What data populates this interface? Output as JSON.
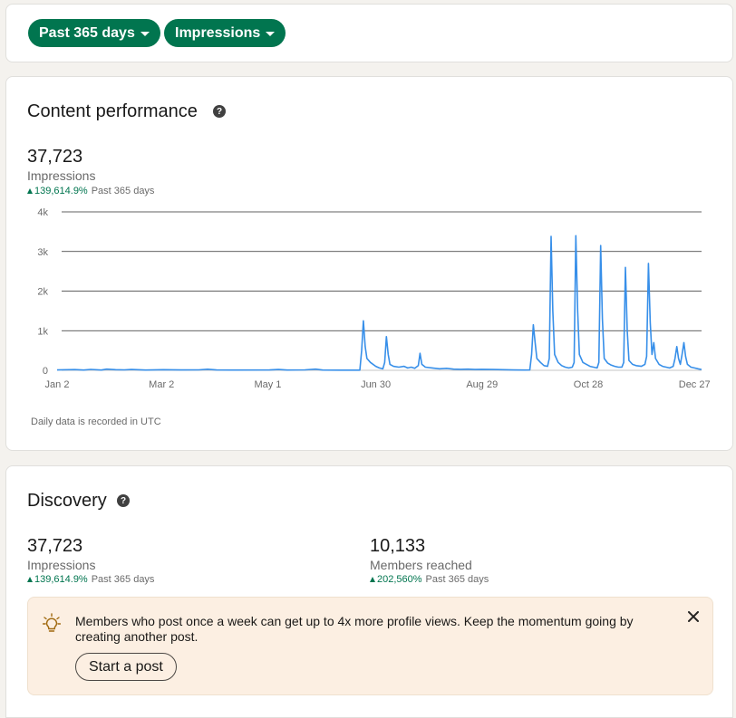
{
  "filters": {
    "period": "Past 365 days",
    "metric": "Impressions"
  },
  "performance": {
    "title": "Content performance",
    "value": "37,723",
    "label": "Impressions",
    "change": "139,614.9%",
    "change_period": "Past 365 days",
    "footnote": "Daily data is recorded in UTC"
  },
  "discovery": {
    "title": "Discovery",
    "impressions_value": "37,723",
    "impressions_label": "Impressions",
    "impressions_change": "139,614.9%",
    "impressions_period": "Past 365 days",
    "members_value": "10,133",
    "members_label": "Members reached",
    "members_change": "202,560%",
    "members_period": "Past 365 days"
  },
  "tip": {
    "text": "Members who post once a week can get up to 4x more profile views. Keep the momentum going by creating another post.",
    "button": "Start a post",
    "icon": "lightbulb-icon",
    "close_icon": "close-icon"
  },
  "colors": {
    "brand_green": "#01754f",
    "line_blue": "#378fe9",
    "tip_bg": "#fcefe2"
  },
  "chart_data": {
    "type": "line",
    "ylim": [
      0,
      4000
    ],
    "y_ticks": [
      "0",
      "1k",
      "2k",
      "3k",
      "4k"
    ],
    "y_tick_values": [
      0,
      1000,
      2000,
      3000,
      4000
    ],
    "x_ticks": [
      "Jan 2",
      "Mar 2",
      "May 1",
      "Jun 30",
      "Aug 29",
      "Oct 28",
      "Dec 27"
    ],
    "x_tick_days": [
      0,
      59,
      119,
      180,
      240,
      300,
      360
    ],
    "grid": true,
    "series": [
      {
        "points": [
          [
            0,
            10
          ],
          [
            10,
            18
          ],
          [
            15,
            8
          ],
          [
            19,
            22
          ],
          [
            25,
            8
          ],
          [
            28,
            30
          ],
          [
            30,
            26
          ],
          [
            33,
            15
          ],
          [
            38,
            12
          ],
          [
            42,
            20
          ],
          [
            50,
            8
          ],
          [
            60,
            15
          ],
          [
            70,
            10
          ],
          [
            80,
            12
          ],
          [
            85,
            28
          ],
          [
            90,
            10
          ],
          [
            100,
            8
          ],
          [
            120,
            10
          ],
          [
            125,
            20
          ],
          [
            130,
            8
          ],
          [
            140,
            12
          ],
          [
            146,
            30
          ],
          [
            150,
            8
          ],
          [
            160,
            5
          ],
          [
            171,
            5
          ],
          [
            172,
            500
          ],
          [
            173,
            1250
          ],
          [
            174,
            600
          ],
          [
            175,
            300
          ],
          [
            177,
            200
          ],
          [
            180,
            100
          ],
          [
            182,
            60
          ],
          [
            184,
            40
          ],
          [
            185,
            200
          ],
          [
            186,
            850
          ],
          [
            187,
            400
          ],
          [
            188,
            150
          ],
          [
            190,
            100
          ],
          [
            193,
            80
          ],
          [
            196,
            100
          ],
          [
            198,
            60
          ],
          [
            200,
            80
          ],
          [
            202,
            50
          ],
          [
            204,
            120
          ],
          [
            205,
            430
          ],
          [
            206,
            150
          ],
          [
            208,
            80
          ],
          [
            212,
            60
          ],
          [
            216,
            40
          ],
          [
            220,
            50
          ],
          [
            224,
            30
          ],
          [
            228,
            25
          ],
          [
            232,
            30
          ],
          [
            236,
            20
          ],
          [
            240,
            25
          ],
          [
            246,
            20
          ],
          [
            252,
            15
          ],
          [
            258,
            10
          ],
          [
            264,
            8
          ],
          [
            267,
            10
          ],
          [
            268,
            400
          ],
          [
            269,
            1150
          ],
          [
            270,
            700
          ],
          [
            271,
            300
          ],
          [
            273,
            200
          ],
          [
            275,
            120
          ],
          [
            277,
            100
          ],
          [
            278,
            300
          ],
          [
            279,
            3380
          ],
          [
            280,
            1500
          ],
          [
            281,
            400
          ],
          [
            283,
            200
          ],
          [
            285,
            120
          ],
          [
            287,
            80
          ],
          [
            289,
            60
          ],
          [
            291,
            80
          ],
          [
            292,
            200
          ],
          [
            293,
            3400
          ],
          [
            294,
            1500
          ],
          [
            295,
            400
          ],
          [
            297,
            200
          ],
          [
            299,
            150
          ],
          [
            301,
            100
          ],
          [
            303,
            80
          ],
          [
            305,
            60
          ],
          [
            306,
            200
          ],
          [
            307,
            3150
          ],
          [
            308,
            1300
          ],
          [
            309,
            300
          ],
          [
            311,
            180
          ],
          [
            313,
            130
          ],
          [
            315,
            100
          ],
          [
            317,
            80
          ],
          [
            319,
            80
          ],
          [
            320,
            200
          ],
          [
            321,
            2600
          ],
          [
            322,
            1000
          ],
          [
            323,
            250
          ],
          [
            325,
            150
          ],
          [
            327,
            120
          ],
          [
            330,
            100
          ],
          [
            332,
            150
          ],
          [
            333,
            350
          ],
          [
            334,
            2700
          ],
          [
            335,
            1200
          ],
          [
            336,
            400
          ],
          [
            337,
            700
          ],
          [
            338,
            300
          ],
          [
            340,
            150
          ],
          [
            342,
            100
          ],
          [
            344,
            80
          ],
          [
            346,
            60
          ],
          [
            348,
            100
          ],
          [
            349,
            300
          ],
          [
            350,
            600
          ],
          [
            351,
            300
          ],
          [
            352,
            150
          ],
          [
            353,
            400
          ],
          [
            354,
            700
          ],
          [
            355,
            350
          ],
          [
            356,
            150
          ],
          [
            358,
            80
          ],
          [
            360,
            60
          ],
          [
            362,
            40
          ],
          [
            364,
            20
          ]
        ]
      }
    ]
  }
}
